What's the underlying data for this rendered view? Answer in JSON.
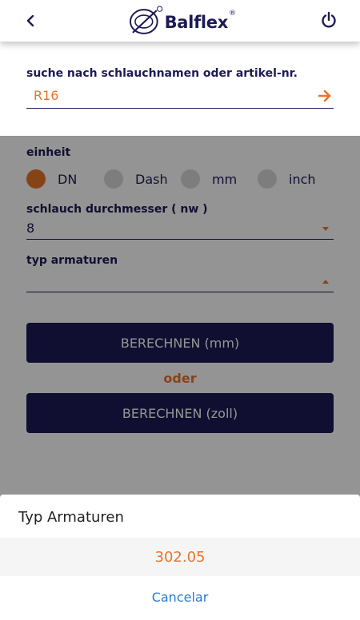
{
  "header": {
    "logo_text": "Balflex",
    "logo_reg": "®",
    "back_icon": "chevron-left-icon",
    "power_icon": "power-icon"
  },
  "search": {
    "label": "suche nach schlauchnamen oder artikel-nr.",
    "value": "R16",
    "arrow_icon": "arrow-right-icon"
  },
  "unit": {
    "label": "einheit",
    "options": [
      "DN",
      "Dash",
      "mm",
      "inch"
    ],
    "selected": "DN"
  },
  "diameter": {
    "label": "schlauch durchmesser ( nw )",
    "value": "8"
  },
  "fitting": {
    "label": "typ armaturen",
    "value": ""
  },
  "buttons": {
    "calc_mm": "BERECHNEN (mm)",
    "or": "oder",
    "calc_zoll": "BERECHNEN (zoll)"
  },
  "sheet": {
    "title": "Typ Armaturen",
    "option": "302.05",
    "cancel": "Cancelar"
  },
  "colors": {
    "brand": "#1e1a55",
    "accent": "#e9742a",
    "cancel": "#2a7ad1"
  }
}
